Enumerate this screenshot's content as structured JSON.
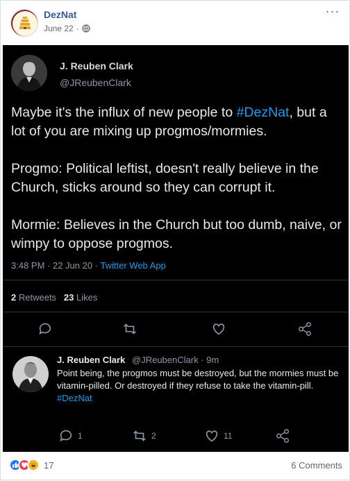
{
  "post": {
    "page_name": "DezNat",
    "date": "June 22",
    "privacy_separator": "·",
    "more_label": "···"
  },
  "tweet": {
    "author_name": "J. Reuben Clark",
    "author_handle": "@JReubenClark",
    "paragraph1_pre": "Maybe it's the influx of new people to ",
    "paragraph1_tag": "#DezNat",
    "paragraph1_post": ", but a lot of you are mixing up progmos/mormies.",
    "paragraph2": "Progmo: Political leftist, doesn't really believe in the Church, sticks around so they can corrupt it.",
    "paragraph3": "Mormie: Believes in the Church but too dumb, naive, or wimpy to oppose progmos.",
    "time": "3:48 PM · 22 Jun 20 · ",
    "source": "Twitter Web App",
    "retweets_count": "2",
    "retweets_label": "Retweets",
    "likes_count": "23",
    "likes_label": "Likes"
  },
  "reply": {
    "author_name": "J. Reuben Clark",
    "author_handle_time": "@JReubenClark · 9m",
    "text": "Point being, the progmos must be destroyed, but the mormies must be vitamin-pilled. Or destroyed if they refuse to take the vitamin-pill.",
    "hashtag": "#DezNat",
    "reply_count": "1",
    "retweet_count": "2",
    "like_count": "11"
  },
  "footer": {
    "reactions_count": "17",
    "comments_label": "6 Comments"
  },
  "colors": {
    "facebook_link": "#385898",
    "twitter_blue": "#1d9bf0",
    "tweet_bg": "#000000"
  }
}
